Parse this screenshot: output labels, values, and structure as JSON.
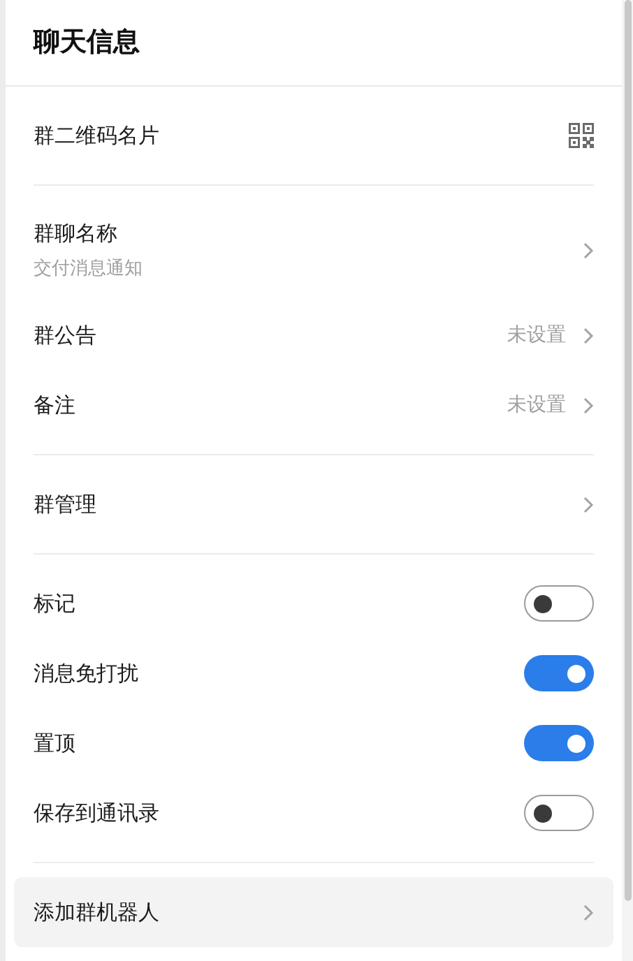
{
  "title": "聊天信息",
  "sections": [
    {
      "items": [
        {
          "kind": "qr",
          "label": "群二维码名片"
        }
      ]
    },
    {
      "items": [
        {
          "kind": "nav",
          "label": "群聊名称",
          "subtitle": "交付消息通知"
        },
        {
          "kind": "nav",
          "label": "群公告",
          "value": "未设置"
        },
        {
          "kind": "nav",
          "label": "备注",
          "value": "未设置"
        }
      ]
    },
    {
      "items": [
        {
          "kind": "nav",
          "label": "群管理"
        }
      ]
    },
    {
      "items": [
        {
          "kind": "toggle",
          "label": "标记",
          "on": false
        },
        {
          "kind": "toggle",
          "label": "消息免打扰",
          "on": true
        },
        {
          "kind": "toggle",
          "label": "置顶",
          "on": true
        },
        {
          "kind": "toggle",
          "label": "保存到通讯录",
          "on": false
        }
      ]
    },
    {
      "items": [
        {
          "kind": "nav",
          "label": "添加群机器人",
          "highlighted": true
        }
      ]
    }
  ]
}
